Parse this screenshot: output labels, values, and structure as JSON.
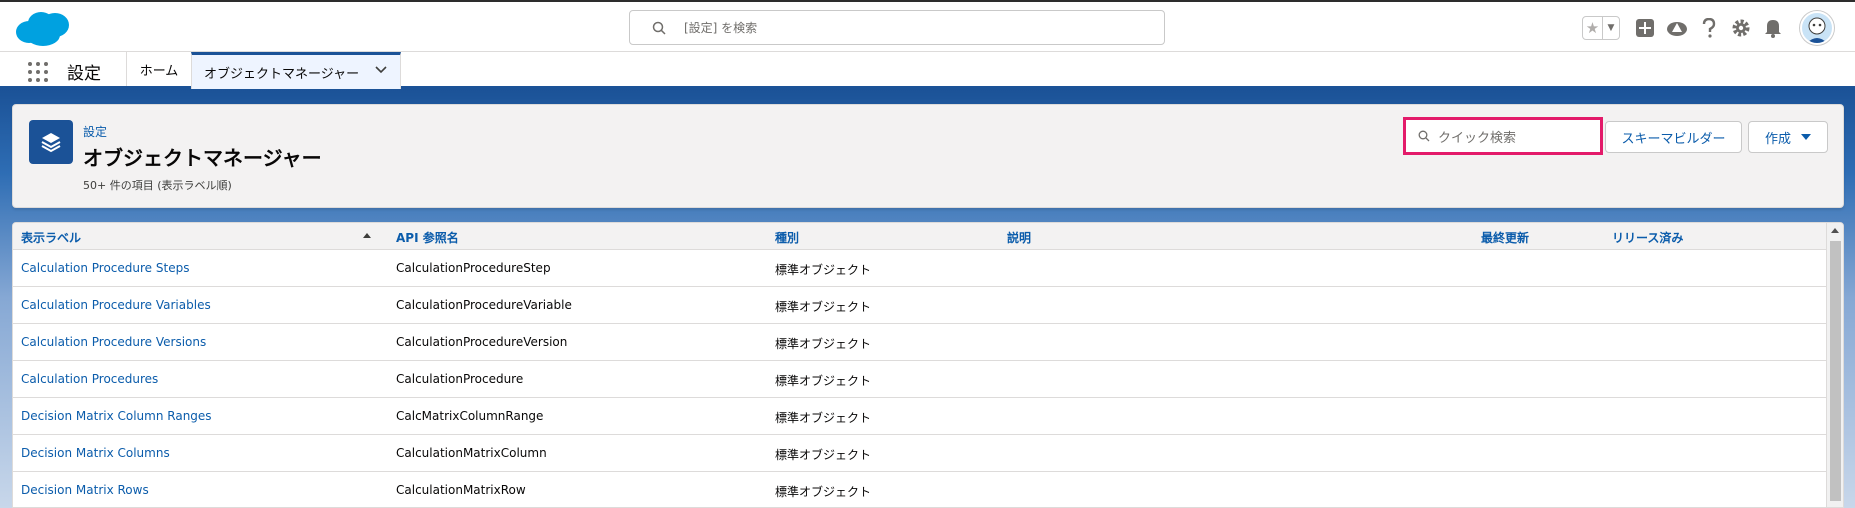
{
  "global_header": {
    "search_placeholder": "[設定] を検索",
    "icons": [
      "cloud-logo-icon",
      "search-icon",
      "favorites-star-icon",
      "favorites-dropdown-icon",
      "global-actions-icon",
      "trailhead-icon",
      "help-icon",
      "setup-gear-icon",
      "notifications-bell-icon",
      "user-avatar-icon"
    ]
  },
  "app_nav": {
    "app_name": "設定",
    "tabs": [
      {
        "label": "ホーム"
      },
      {
        "label": "オブジェクトマネージャー"
      }
    ]
  },
  "page_header": {
    "breadcrumb": "設定",
    "title": "オブジェクトマネージャー",
    "meta": "50+ 件の項目 (表示ラベル順)",
    "quick_find_placeholder": "クイック検索",
    "schema_builder_label": "スキーマビルダー",
    "create_label": "作成"
  },
  "table": {
    "columns": [
      "表示ラベル",
      "API 参照名",
      "種別",
      "説明",
      "最終更新",
      "リリース済み"
    ],
    "rows": [
      {
        "label": "Calculation Procedure Steps",
        "api": "CalculationProcedureStep",
        "type": "標準オブジェクト"
      },
      {
        "label": "Calculation Procedure Variables",
        "api": "CalculationProcedureVariable",
        "type": "標準オブジェクト"
      },
      {
        "label": "Calculation Procedure Versions",
        "api": "CalculationProcedureVersion",
        "type": "標準オブジェクト"
      },
      {
        "label": "Calculation Procedures",
        "api": "CalculationProcedure",
        "type": "標準オブジェクト"
      },
      {
        "label": "Decision Matrix Column Ranges",
        "api": "CalcMatrixColumnRange",
        "type": "標準オブジェクト"
      },
      {
        "label": "Decision Matrix Columns",
        "api": "CalculationMatrixColumn",
        "type": "標準オブジェクト"
      },
      {
        "label": "Decision Matrix Rows",
        "api": "CalculationMatrixRow",
        "type": "標準オブジェクト"
      }
    ]
  },
  "colors": {
    "brand_blue": "#1b5297",
    "link_blue": "#0b5cab",
    "highlight_pink": "#e31b6a",
    "cloud_blue": "#00a1e0"
  }
}
